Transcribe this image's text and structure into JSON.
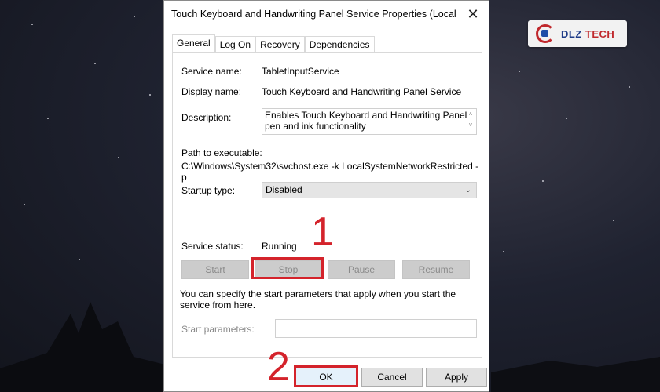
{
  "window": {
    "title": "Touch Keyboard and Handwriting Panel Service Properties (Local C...",
    "close_symbol": "✕"
  },
  "tabs": [
    {
      "label": "General",
      "active": true
    },
    {
      "label": "Log On",
      "active": false
    },
    {
      "label": "Recovery",
      "active": false
    },
    {
      "label": "Dependencies",
      "active": false
    }
  ],
  "general": {
    "service_name_label": "Service name:",
    "service_name": "TabletInputService",
    "display_name_label": "Display name:",
    "display_name": "Touch Keyboard and Handwriting Panel Service",
    "description_label": "Description:",
    "description": "Enables Touch Keyboard and Handwriting Panel pen and ink functionality",
    "path_label": "Path to executable:",
    "path": "C:\\Windows\\System32\\svchost.exe -k LocalSystemNetworkRestricted -p",
    "startup_type_label": "Startup type:",
    "startup_type": "Disabled",
    "service_status_label": "Service status:",
    "service_status": "Running",
    "buttons": {
      "start": "Start",
      "stop": "Stop",
      "pause": "Pause",
      "resume": "Resume"
    },
    "hint": "You can specify the start parameters that apply when you start the service from here.",
    "start_params_label": "Start parameters:",
    "start_params_value": ""
  },
  "footer": {
    "ok": "OK",
    "cancel": "Cancel",
    "apply": "Apply"
  },
  "annotations": {
    "step1": "1",
    "step2": "2",
    "color": "#d4232b"
  },
  "logo": {
    "text_blue": "DLZ",
    "text_red": "TECH"
  }
}
